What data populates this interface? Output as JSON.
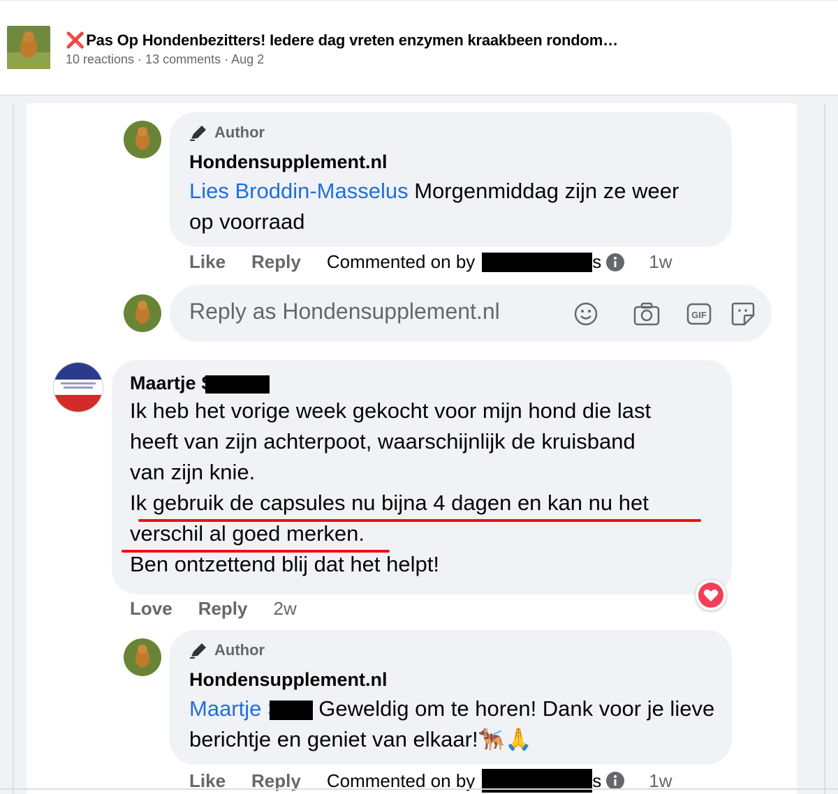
{
  "post": {
    "title_mark": "❌",
    "title": "Pas Op Hondenbezitters! Iedere dag vreten enzymen kraakbeen rondom…",
    "meta": "10 reactions · 13 comments · Aug 2"
  },
  "comments": [
    {
      "author_tag": "Author",
      "name": "Hondensupplement.nl",
      "mention": "Lies Broddin-Masselus",
      "text": " Morgenmiddag zijn ze weer op voorraad",
      "actions": {
        "like": "Like",
        "reply": "Reply",
        "commented": "Commented on by",
        "commented_tail": "s",
        "time": "1w"
      }
    },
    {
      "name": "Maartje S",
      "lines": [
        "Ik heb het vorige week gekocht voor mijn hond die last",
        "heeft van zijn achterpoot, waarschijnlijk de kruisband",
        "van zijn knie.",
        "Ik gebruik de capsules nu bijna 4 dagen en kan nu het",
        "verschil al goed merken.",
        "Ben ontzettend blij dat het helpt!"
      ],
      "actions": {
        "like": "Love",
        "reply": "Reply",
        "time": "2w"
      }
    },
    {
      "author_tag": "Author",
      "name": "Hondensupplement.nl",
      "mention": "Maartje S",
      "text": " Geweldig om te horen! Dank voor je lieve berichtje en geniet van elkaar!",
      "emoji": "🐕‍🦺🙏",
      "actions": {
        "like": "Like",
        "reply": "Reply",
        "commented": "Commented on by",
        "commented_tail": "s",
        "time": "1w"
      }
    }
  ],
  "reply_box": {
    "placeholder": "Reply as Hondensupplement.nl",
    "icons": [
      "smiley-icon",
      "camera-icon",
      "gif-icon",
      "sticker-icon"
    ]
  },
  "colors": {
    "mention": "#216fdb",
    "underline": "#e11111",
    "love": "#f33e58"
  }
}
